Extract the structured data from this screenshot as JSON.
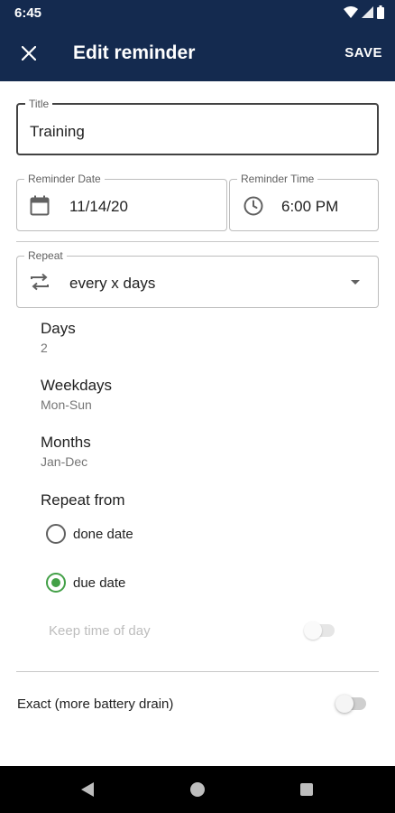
{
  "status_bar": {
    "time": "6:45",
    "icons": [
      "wifi-icon",
      "signal-icon",
      "battery-icon"
    ]
  },
  "app_bar": {
    "title": "Edit reminder",
    "save_label": "SAVE",
    "close_icon": "close-icon"
  },
  "title_field": {
    "label": "Title",
    "value": "Training"
  },
  "date_field": {
    "label": "Reminder Date",
    "value": "11/14/20",
    "icon": "calendar-icon"
  },
  "time_field": {
    "label": "Reminder Time",
    "value": "6:00 PM",
    "icon": "clock-icon"
  },
  "repeat_field": {
    "label": "Repeat",
    "value": "every x days",
    "icon": "repeat-icon"
  },
  "settings": {
    "days": {
      "label": "Days",
      "value": "2"
    },
    "weekdays": {
      "label": "Weekdays",
      "value": "Mon-Sun"
    },
    "months": {
      "label": "Months",
      "value": "Jan-Dec"
    }
  },
  "repeat_from": {
    "label": "Repeat from",
    "options": [
      {
        "label": "done date",
        "checked": false
      },
      {
        "label": "due date",
        "checked": true
      }
    ]
  },
  "keep_time": {
    "label": "Keep time of day",
    "enabled": false,
    "on": false
  },
  "exact": {
    "label": "Exact (more battery drain)",
    "on": false
  },
  "colors": {
    "app_bar": "#142a4f",
    "accent": "#43a047",
    "disabled_text": "#bdbdbd"
  }
}
